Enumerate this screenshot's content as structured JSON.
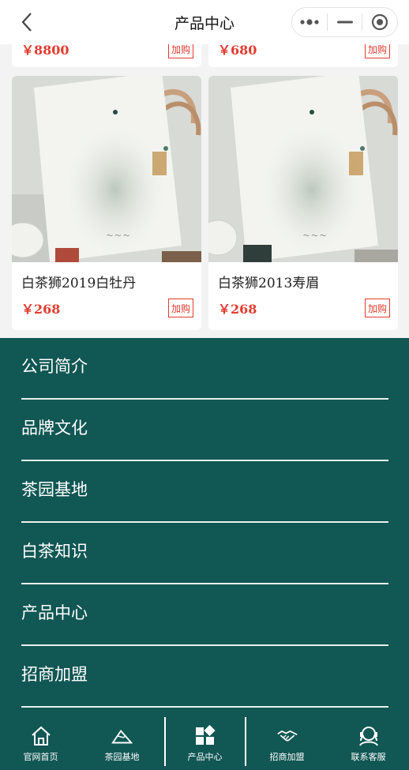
{
  "header": {
    "title": "产品中心"
  },
  "products_top": [
    {
      "price": "￥8800",
      "buy_label": "加购"
    },
    {
      "price": "￥680",
      "buy_label": "加购"
    }
  ],
  "products": [
    {
      "name": "白茶狮2019白牡丹",
      "price": "￥268",
      "buy_label": "加购"
    },
    {
      "name": "白茶狮2013寿眉",
      "price": "￥268",
      "buy_label": "加购"
    }
  ],
  "menu": {
    "items": [
      {
        "label": "公司简介"
      },
      {
        "label": "品牌文化"
      },
      {
        "label": "茶园基地"
      },
      {
        "label": "白茶知识"
      },
      {
        "label": "产品中心"
      },
      {
        "label": "招商加盟"
      }
    ]
  },
  "tabbar": {
    "items": [
      {
        "label": "官网首页",
        "icon": "home-icon"
      },
      {
        "label": "茶园基地",
        "icon": "mountain-icon"
      },
      {
        "label": "产品中心",
        "icon": "grid-icon"
      },
      {
        "label": "招商加盟",
        "icon": "handshake-icon"
      },
      {
        "label": "联系客服",
        "icon": "headset-icon"
      }
    ]
  },
  "colors": {
    "accent": "#115754",
    "price": "#e23b2f"
  }
}
